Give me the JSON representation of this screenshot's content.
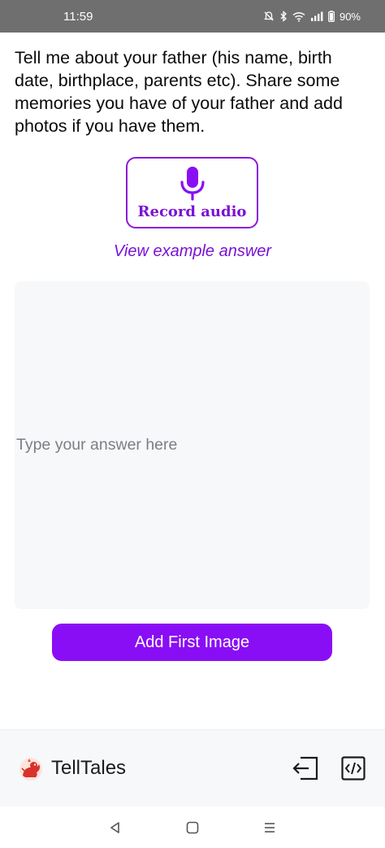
{
  "status_bar": {
    "time": "11:59",
    "battery": "90%",
    "icons": [
      "mute-icon",
      "bluetooth-icon",
      "wifi-icon",
      "signal-icon",
      "battery-icon"
    ]
  },
  "question": {
    "text": "Tell me about your father (his name, birth date, birthplace, parents etc). Share some memories you have of your father and add photos if you have them."
  },
  "record": {
    "label": "Record audio",
    "icon": "microphone-icon"
  },
  "example_link": {
    "label": "View example answer"
  },
  "answer": {
    "placeholder": "Type your answer here",
    "value": ""
  },
  "add_image": {
    "label": "Add First Image"
  },
  "app_bar": {
    "brand": "TellTales",
    "logo_icon": "telltales-logo-icon",
    "actions": [
      "exit-icon",
      "code-icon"
    ]
  },
  "nav": {
    "buttons": [
      "back-icon",
      "home-icon",
      "menu-icon"
    ]
  },
  "colors": {
    "accent": "#8a0ef5",
    "accent_text": "#7a12d4",
    "status_bar_bg": "#6f6f6f",
    "panel_bg": "#f7f8fa"
  }
}
